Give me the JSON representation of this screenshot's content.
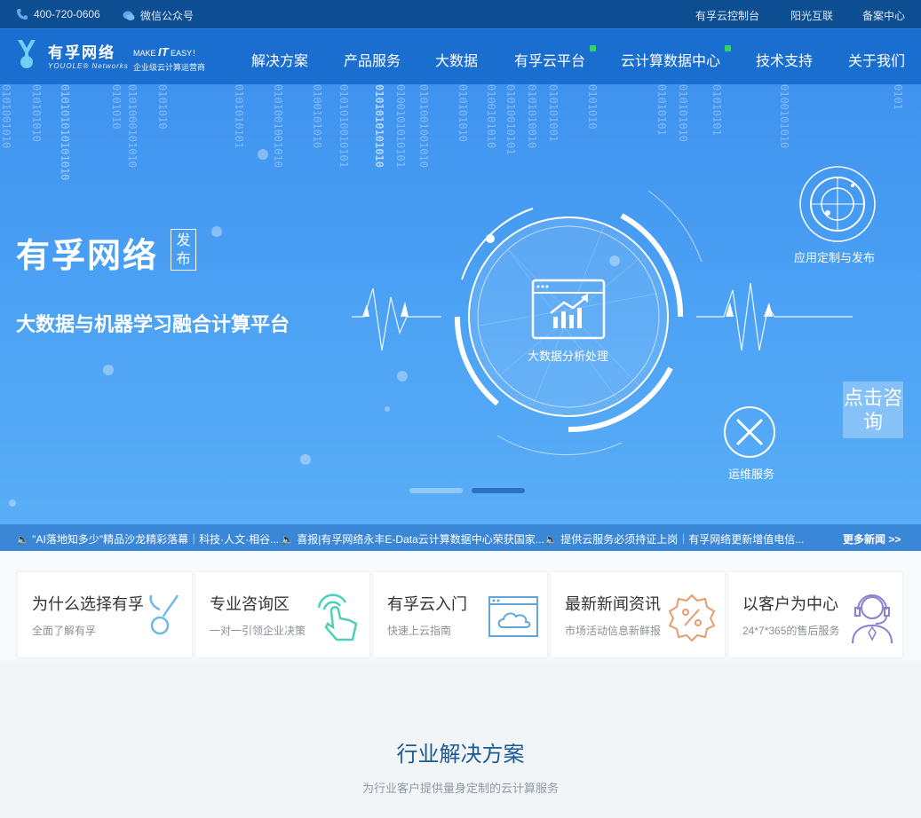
{
  "topbar": {
    "phone": "400-720-0606",
    "wechat": "微信公众号",
    "links": [
      "有孚云控制台",
      "阳光互联",
      "备案中心"
    ]
  },
  "logo": {
    "cn": "有孚网络",
    "en": "YOUOLE® Networks",
    "tag_make": "MAKE",
    "tag_it": "IT",
    "tag_easy": "EASY！",
    "tag_cn": "企业级云计算运营商"
  },
  "nav": {
    "items": [
      "解决方案",
      "产品服务",
      "大数据",
      "有孚云平台",
      "云计算数据中心",
      "技术支持",
      "关于我们"
    ],
    "dot_color": "#34d36a"
  },
  "banner": {
    "title": "有孚网络",
    "tag": "发布",
    "subtitle": "大数据与机器学习融合计算平台",
    "hub_label": "大数据分析处理",
    "app_label": "应用定制与发布",
    "ops_label": "运维服务",
    "consult": "点击咨询"
  },
  "ticker": {
    "items": [
      "\"AI落地知多少\"精品沙龙精彩落幕｜科技·人文·相谷...",
      "喜报|有孚网络永丰E-Data云计算数据中心荣获国家...",
      "提供云服务必须持证上岗｜有孚网络更新增值电信..."
    ],
    "more": "更多新闻 >>"
  },
  "cards": [
    {
      "title": "为什么选择有孚",
      "sub": "全面了解有孚",
      "icon": "logo-y-icon"
    },
    {
      "title": "专业咨询区",
      "sub": "一对一引领企业决策",
      "icon": "touch-hand-icon"
    },
    {
      "title": "有孚云入门",
      "sub": "快速上云指南",
      "icon": "cloud-window-icon"
    },
    {
      "title": "最新新闻资讯",
      "sub": "市场活动信息新鲜报",
      "icon": "percent-badge-icon"
    },
    {
      "title": "以客户为中心",
      "sub": "24*7*365的售后服务",
      "icon": "headset-agent-icon"
    }
  ],
  "section": {
    "title": "行业解决方案",
    "subtitle": "为行业客户提供量身定制的云计算服务"
  },
  "colors": {
    "topbar": "#0d4e93",
    "header": "#1a6ecf",
    "ticker": "#3a87d8",
    "section_title": "#1c5a96"
  }
}
